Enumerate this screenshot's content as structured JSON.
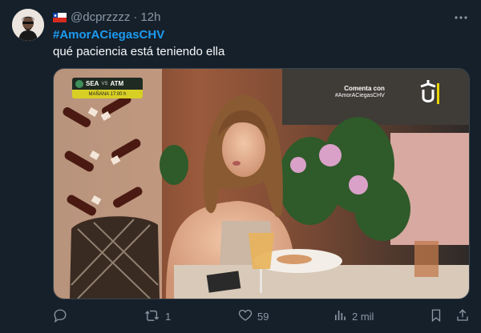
{
  "author": {
    "handle": "@dcprzzzz",
    "time": "12h",
    "country_flag": "chile-flag-icon"
  },
  "tweet": {
    "hashtag": "#AmorACiegasCHV",
    "text": "qué paciencia está teniendo ella"
  },
  "media": {
    "scoreboard": {
      "team1": "SEA",
      "vs": "VS",
      "team2": "ATM",
      "schedule": "MAÑANA 17:00 h"
    },
    "overlay": {
      "line1": "Comenta con",
      "line2": "#AmorACiegasCHV"
    },
    "channel_logo": "chv-logo"
  },
  "actions": {
    "reply": {
      "icon": "reply-icon",
      "count": ""
    },
    "retweet": {
      "icon": "retweet-icon",
      "count": "1"
    },
    "like": {
      "icon": "heart-icon",
      "count": "59"
    },
    "views": {
      "icon": "views-icon",
      "count": "2 mil"
    },
    "bookmark": {
      "icon": "bookmark-icon"
    },
    "share": {
      "icon": "share-icon"
    }
  },
  "colors": {
    "background": "#15202b",
    "accent": "#1d9bf0",
    "secondary_text": "#8b98a5",
    "primary_text": "#f7f9f9"
  }
}
